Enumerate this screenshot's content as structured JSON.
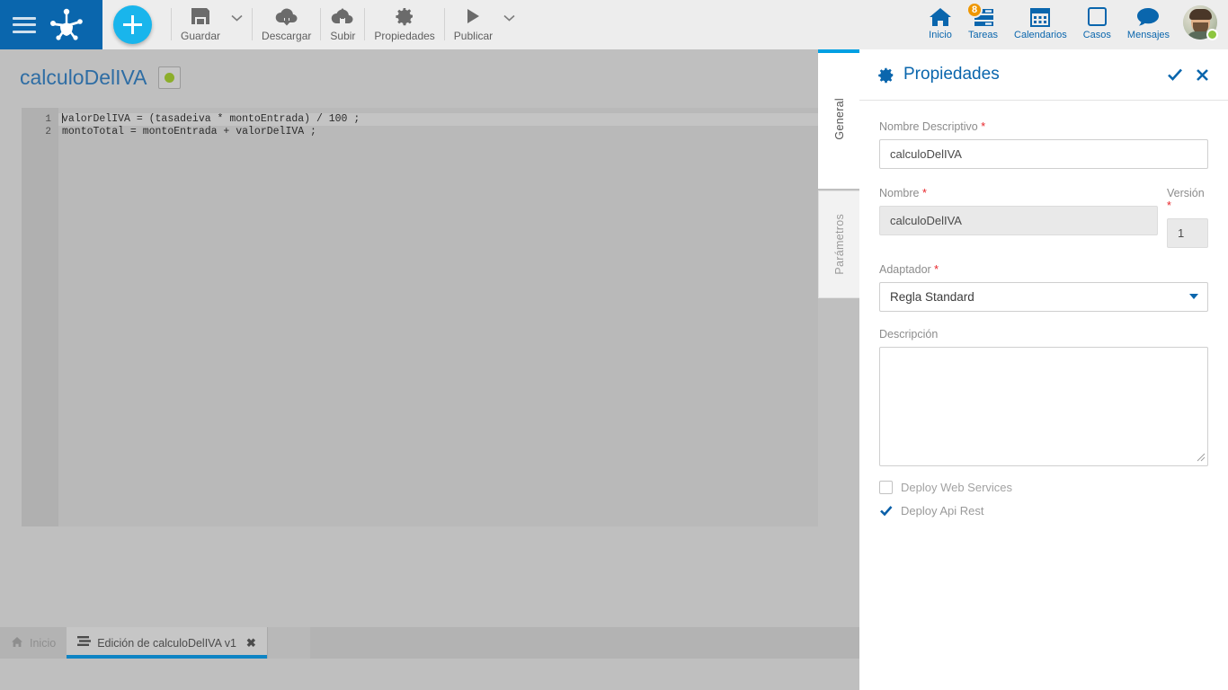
{
  "topbar": {
    "menu_icon": "hamburger-icon",
    "logo_icon": "app-logo-icon",
    "add_button_label": "+",
    "tools": [
      {
        "label": "Guardar",
        "icon": "save-icon",
        "has_caret": true
      },
      {
        "label": "Descargar",
        "icon": "download-cloud-icon",
        "has_caret": false
      },
      {
        "label": "Subir",
        "icon": "upload-cloud-icon",
        "has_caret": false
      },
      {
        "label": "Propiedades",
        "icon": "gear-icon",
        "has_caret": false
      },
      {
        "label": "Publicar",
        "icon": "play-icon",
        "has_caret": true
      }
    ],
    "nav": [
      {
        "label": "Inicio",
        "icon": "home-icon",
        "badge": ""
      },
      {
        "label": "Tareas",
        "icon": "tasks-icon",
        "badge": "8"
      },
      {
        "label": "Calendarios",
        "icon": "calendar-icon",
        "badge": ""
      },
      {
        "label": "Casos",
        "icon": "case-square-icon",
        "badge": ""
      },
      {
        "label": "Mensajes",
        "icon": "chat-bubble-icon",
        "badge": ""
      }
    ],
    "avatar": {
      "name": "avatar",
      "status": "online"
    }
  },
  "workspace": {
    "doc_title": "calculoDelIVA",
    "status_dot": "green",
    "editor": {
      "lines": [
        {
          "number": "1",
          "text": "valorDelIVA = (tasadeiva * montoEntrada) / 100 ;",
          "active": true
        },
        {
          "number": "2",
          "text": "montoTotal = montoEntrada + valorDelIVA ;",
          "active": false
        }
      ]
    }
  },
  "tabs_vertical": [
    {
      "label": "General",
      "active": true
    },
    {
      "label": "Parámetros",
      "active": false
    }
  ],
  "panel": {
    "title": "Propiedades",
    "gear_icon": "gear-icon",
    "accept_icon": "check-icon",
    "close_icon": "close-icon",
    "fields": {
      "nombre_descriptivo_label": "Nombre Descriptivo",
      "nombre_descriptivo_value": "calculoDelIVA",
      "nombre_label": "Nombre",
      "nombre_value": "calculoDelIVA",
      "version_label": "Versión",
      "version_value": "1",
      "adaptador_label": "Adaptador",
      "adaptador_value": "Regla Standard",
      "descripcion_label": "Descripción",
      "descripcion_value": "",
      "required_marker": "*"
    },
    "checkboxes": [
      {
        "label": "Deploy Web Services",
        "checked": false
      },
      {
        "label": "Deploy Api Rest",
        "checked": true
      }
    ]
  },
  "taskbar": {
    "items": [
      {
        "label": "Inicio",
        "icon": "home-icon",
        "active": false,
        "closable": false
      },
      {
        "label": "Edición de calculoDelIVA v1",
        "icon": "rule-lines-icon",
        "active": true,
        "closable": true
      }
    ],
    "close_glyph": "✖"
  },
  "colors": {
    "brand_blue": "#0a66ad",
    "accent_cyan": "#00a0e3",
    "fab_cyan": "#19b5ec",
    "badge_orange": "#ef9700",
    "status_green": "#8cae2b",
    "required_red": "#e8252a",
    "workspace_gray": "#bfbfbf",
    "editor_gray": "#b9b9b9"
  }
}
